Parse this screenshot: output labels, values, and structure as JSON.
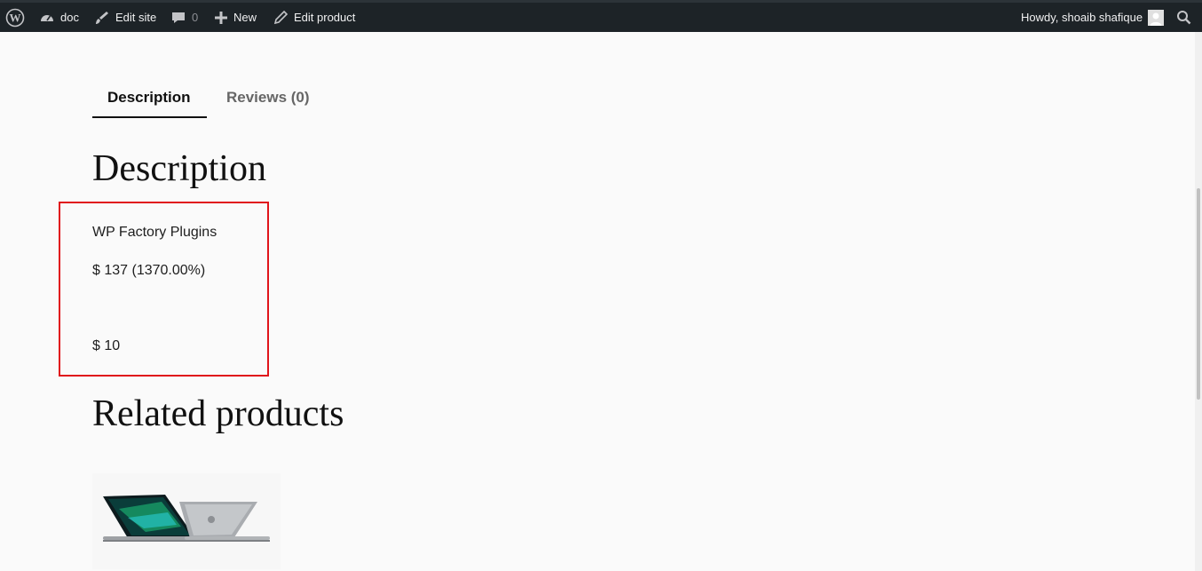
{
  "adminbar": {
    "site_name": "doc",
    "edit_site": "Edit site",
    "comments_count": "0",
    "new_label": "New",
    "edit_product": "Edit product",
    "greeting": "Howdy, shoaib shafique",
    "icons": [
      "wordpress-logo-icon",
      "dashboard-icon",
      "brush-icon",
      "comment-icon",
      "plus-icon",
      "pencil-icon",
      "avatar-icon",
      "search-icon"
    ]
  },
  "tabs": {
    "description": "Description",
    "reviews": "Reviews (0)"
  },
  "description": {
    "heading": "Description",
    "lines": [
      "WP Factory Plugins",
      "$ 137 (1370.00%)",
      "$ 10"
    ]
  },
  "related": {
    "heading": "Related products"
  },
  "colors": {
    "adminbar_bg": "#1d2327",
    "highlight": "#e0141b",
    "page_bg": "#fafafa"
  }
}
